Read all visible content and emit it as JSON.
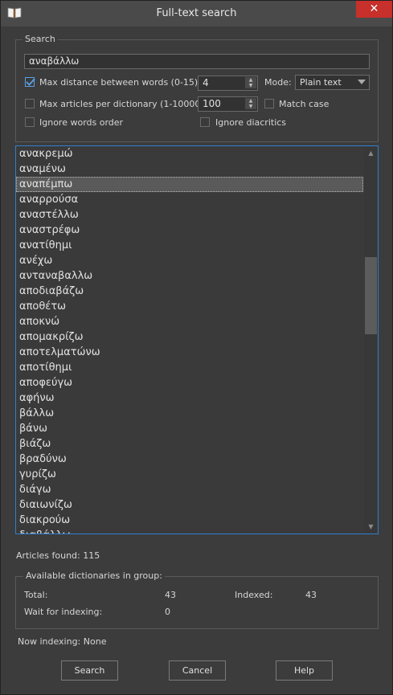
{
  "window": {
    "title": "Full-text search",
    "close_glyph": "✕"
  },
  "search": {
    "legend": "Search",
    "query": "αναβάλλω",
    "max_distance_label": "Max distance between words (0-15):",
    "max_distance_value": "4",
    "max_distance_checked": true,
    "mode_label": "Mode:",
    "mode_value": "Plain text",
    "max_articles_label": "Max articles per dictionary (1-10000):",
    "max_articles_value": "100",
    "max_articles_checked": false,
    "match_case_label": "Match case",
    "match_case_checked": false,
    "ignore_order_label": "Ignore words order",
    "ignore_order_checked": false,
    "ignore_diacritics_label": "Ignore diacritics",
    "ignore_diacritics_checked": false
  },
  "results": {
    "items": [
      "ανακρεμώ",
      "αναμένω",
      "αναπέμπω",
      "αναρρούσα",
      "αναστέλλω",
      "αναστρέφω",
      "ανατίθημι",
      "ανέχω",
      "ανταναβαλλω",
      "αποδιαβάζω",
      "αποθέτω",
      "αποκνώ",
      "απομακρίζω",
      "αποτελματώνω",
      "αποτίθημι",
      "αποφεύγω",
      "αφήνω",
      "βάλλω",
      "βάνω",
      "βιάζω",
      "βραδύνω",
      "γυρίζω",
      "διάγω",
      "διαιωνίζω",
      "διακρούω",
      "διαβάλλω"
    ],
    "selected_index": 2,
    "articles_found": "Articles found: 115"
  },
  "dictionaries": {
    "legend": "Available dictionaries in group:",
    "total_label": "Total:",
    "total_value": "43",
    "indexed_label": "Indexed:",
    "indexed_value": "43",
    "wait_label": "Wait for indexing:",
    "wait_value": "0"
  },
  "status": {
    "now_indexing": "Now indexing: None"
  },
  "buttons": {
    "search": "Search",
    "cancel": "Cancel",
    "help": "Help"
  },
  "colors": {
    "accent": "#2f7fcf",
    "close": "#c7302b",
    "background": "#3c3c3c"
  },
  "icons": {
    "app": "book-icon",
    "check": "check-icon",
    "close": "close-icon"
  }
}
